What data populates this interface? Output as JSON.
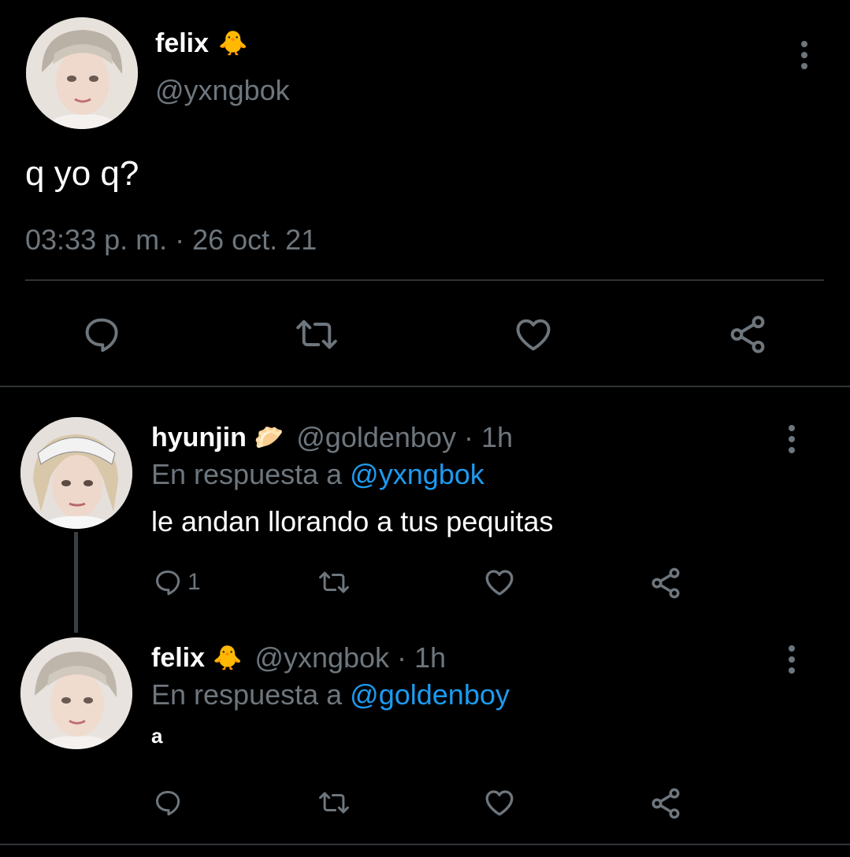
{
  "main_tweet": {
    "author_name": "felix",
    "author_emoji": "🐥",
    "author_handle": "@yxngbok",
    "text": "q yo q?",
    "timestamp": "03:33 p. m. · 26 oct. 21"
  },
  "replies": [
    {
      "author_name": "hyunjin",
      "author_emoji": "🥟",
      "author_handle": "@goldenboy",
      "age": "· 1h",
      "reply_prefix": "En respuesta a",
      "reply_to": "@yxngbok",
      "text": "le andan llorando a tus pequitas",
      "reply_count": "1"
    },
    {
      "author_name": "felix",
      "author_emoji": "🐥",
      "author_handle": "@yxngbok",
      "age": "· 1h",
      "reply_prefix": "En respuesta a",
      "reply_to": "@goldenboy",
      "text": "a",
      "reply_count": ""
    }
  ],
  "icons": {
    "reply": "reply-icon",
    "retweet": "retweet-icon",
    "like": "heart-icon",
    "share": "share-icon",
    "more": "more-options-icon"
  },
  "colors": {
    "background": "#000000",
    "text": "#ffffff",
    "muted": "#6e767d",
    "link": "#1d9bf0",
    "divider": "#2f3336"
  }
}
